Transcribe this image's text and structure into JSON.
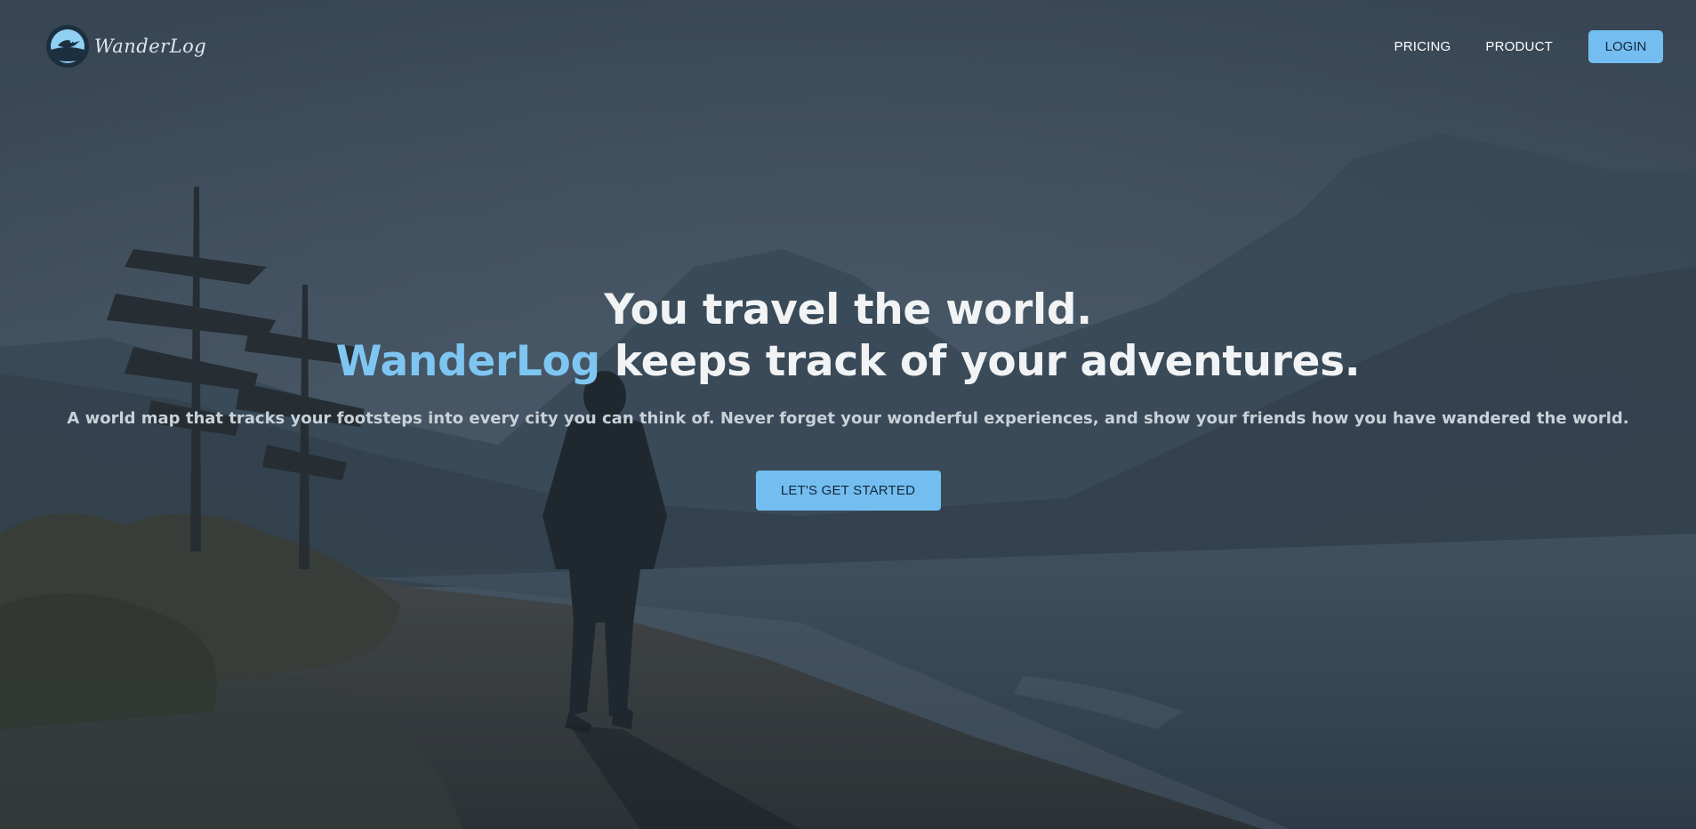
{
  "brand": {
    "logo_text": "WanderLog",
    "logo_icon": "bird-globe-icon"
  },
  "nav": {
    "pricing_label": "PRICING",
    "product_label": "PRODUCT",
    "login_label": "LOGIN"
  },
  "hero": {
    "headline_line1": "You travel the world.",
    "headline_brand": "WanderLog",
    "headline_line2_rest": " keeps track of your adventures.",
    "subtext": "A world map that tracks your footsteps into every city you can think of. Never forget your wonderful experiences, and show your friends how you have wandered the world.",
    "cta_label": "LET'S GET STARTED",
    "background": "person-walking-lakeside-path-misty-mountains"
  },
  "colors": {
    "accent": "#74bdf0",
    "brand_text": "#7ec6f1",
    "headline": "#f1f3f4",
    "button_text": "#13283a"
  }
}
